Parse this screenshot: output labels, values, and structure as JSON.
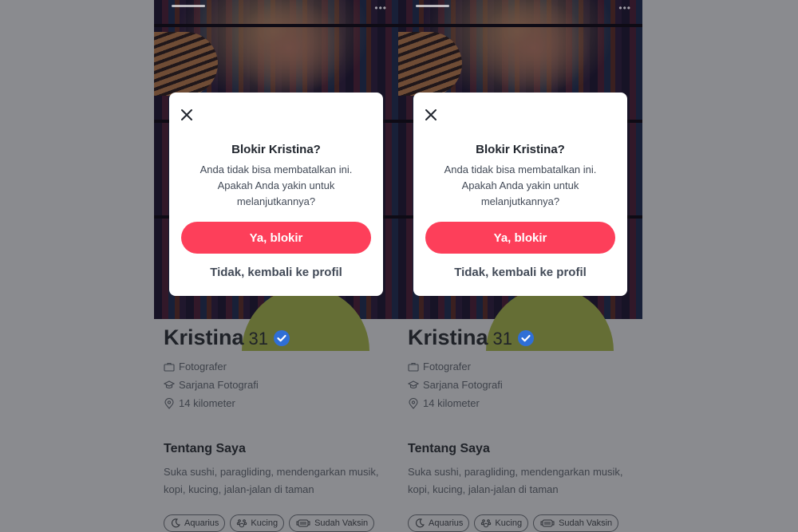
{
  "screens": [
    {
      "dialog": {
        "title": "Blokir Kristina?",
        "message": "Anda tidak bisa membatalkan ini. Apakah Anda yakin untuk melanjutkannya?",
        "confirm_label": "Ya, blokir",
        "cancel_label": "Tidak, kembali ke profil"
      },
      "profile": {
        "name": "Kristina",
        "age": "31",
        "job": "Fotografer",
        "education": "Sarjana Fotografi",
        "distance": "14 kilometer",
        "about_title": "Tentang Saya",
        "about_text": "Suka sushi, paragliding, mendengarkan musik, kopi, kucing, jalan-jalan di taman",
        "chips": [
          "Aquarius",
          "Kucing",
          "Sudah Vaksin"
        ]
      }
    },
    {
      "dialog": {
        "title": "Blokir Kristina?",
        "message": "Anda tidak bisa membatalkan ini. Apakah Anda yakin untuk melanjutkannya?",
        "confirm_label": "Ya, blokir",
        "cancel_label": "Tidak, kembali ke profil"
      },
      "profile": {
        "name": "Kristina",
        "age": "31",
        "job": "Fotografer",
        "education": "Sarjana Fotografi",
        "distance": "14 kilometer",
        "about_title": "Tentang Saya",
        "about_text": "Suka sushi, paragliding, mendengarkan musik, kopi, kucing, jalan-jalan di taman",
        "chips": [
          "Aquarius",
          "Kucing",
          "Sudah Vaksin"
        ]
      }
    }
  ],
  "colors": {
    "accent": "#fd3f5a",
    "verified": "#2f6fd6",
    "overlay": "#8a8b8f"
  },
  "icons": {
    "close": "close-icon",
    "verified": "verified-badge-icon",
    "job": "briefcase-icon",
    "education": "graduation-cap-icon",
    "distance": "location-pin-icon",
    "aquarius": "moon-icon",
    "kucing": "paw-icon",
    "vaksin": "mask-icon"
  }
}
